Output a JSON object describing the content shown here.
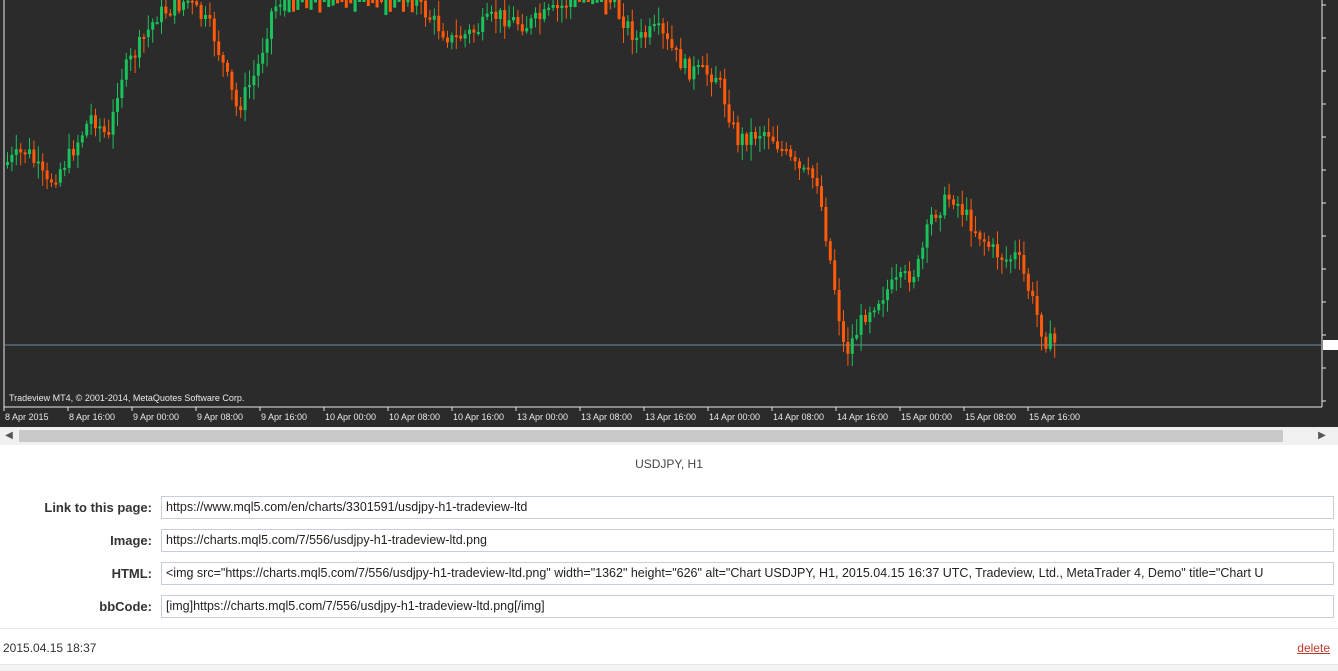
{
  "chart": {
    "copyright": "Tradeview MT4, © 2001-2014, MetaQuotes Software Corp.",
    "caption": "USDJPY, H1",
    "colors": {
      "background": "#2b2b2b",
      "bull": "#19c25a",
      "bear": "#ff5a0a",
      "grid_text": "#e8e8e8",
      "price_line": "#6f8fa6"
    }
  },
  "chart_data": {
    "type": "candlestick",
    "symbol": "USDJPY",
    "timeframe": "H1",
    "x_tick_labels": [
      "8 Apr 2015",
      "8 Apr 16:00",
      "9 Apr 00:00",
      "9 Apr 08:00",
      "9 Apr 16:00",
      "10 Apr 00:00",
      "10 Apr 08:00",
      "10 Apr 16:00",
      "13 Apr 00:00",
      "13 Apr 08:00",
      "13 Apr 16:00",
      "14 Apr 00:00",
      "14 Apr 08:00",
      "14 Apr 16:00",
      "15 Apr 00:00",
      "15 Apr 08:00",
      "15 Apr 16:00"
    ],
    "grid": false,
    "price_line": true,
    "y_labels_visible": false
  },
  "scrollbar": {
    "left_arrow": "◀",
    "right_arrow": "▶"
  },
  "fields": {
    "link": {
      "label": "Link to this page:",
      "value": "https://www.mql5.com/en/charts/3301591/usdjpy-h1-tradeview-ltd"
    },
    "image": {
      "label": "Image:",
      "value": "https://charts.mql5.com/7/556/usdjpy-h1-tradeview-ltd.png"
    },
    "html": {
      "label": "HTML:",
      "value": "<img src=\"https://charts.mql5.com/7/556/usdjpy-h1-tradeview-ltd.png\" width=\"1362\" height=\"626\" alt=\"Chart USDJPY, H1, 2015.04.15 16:37 UTC, Tradeview, Ltd., MetaTrader 4, Demo\" title=\"Chart U"
    },
    "bbcode": {
      "label": "bbCode:",
      "value": "[img]https://charts.mql5.com/7/556/usdjpy-h1-tradeview-ltd.png[/img]"
    }
  },
  "footer": {
    "timestamp": "2015.04.15 18:37",
    "delete_label": "delete"
  }
}
